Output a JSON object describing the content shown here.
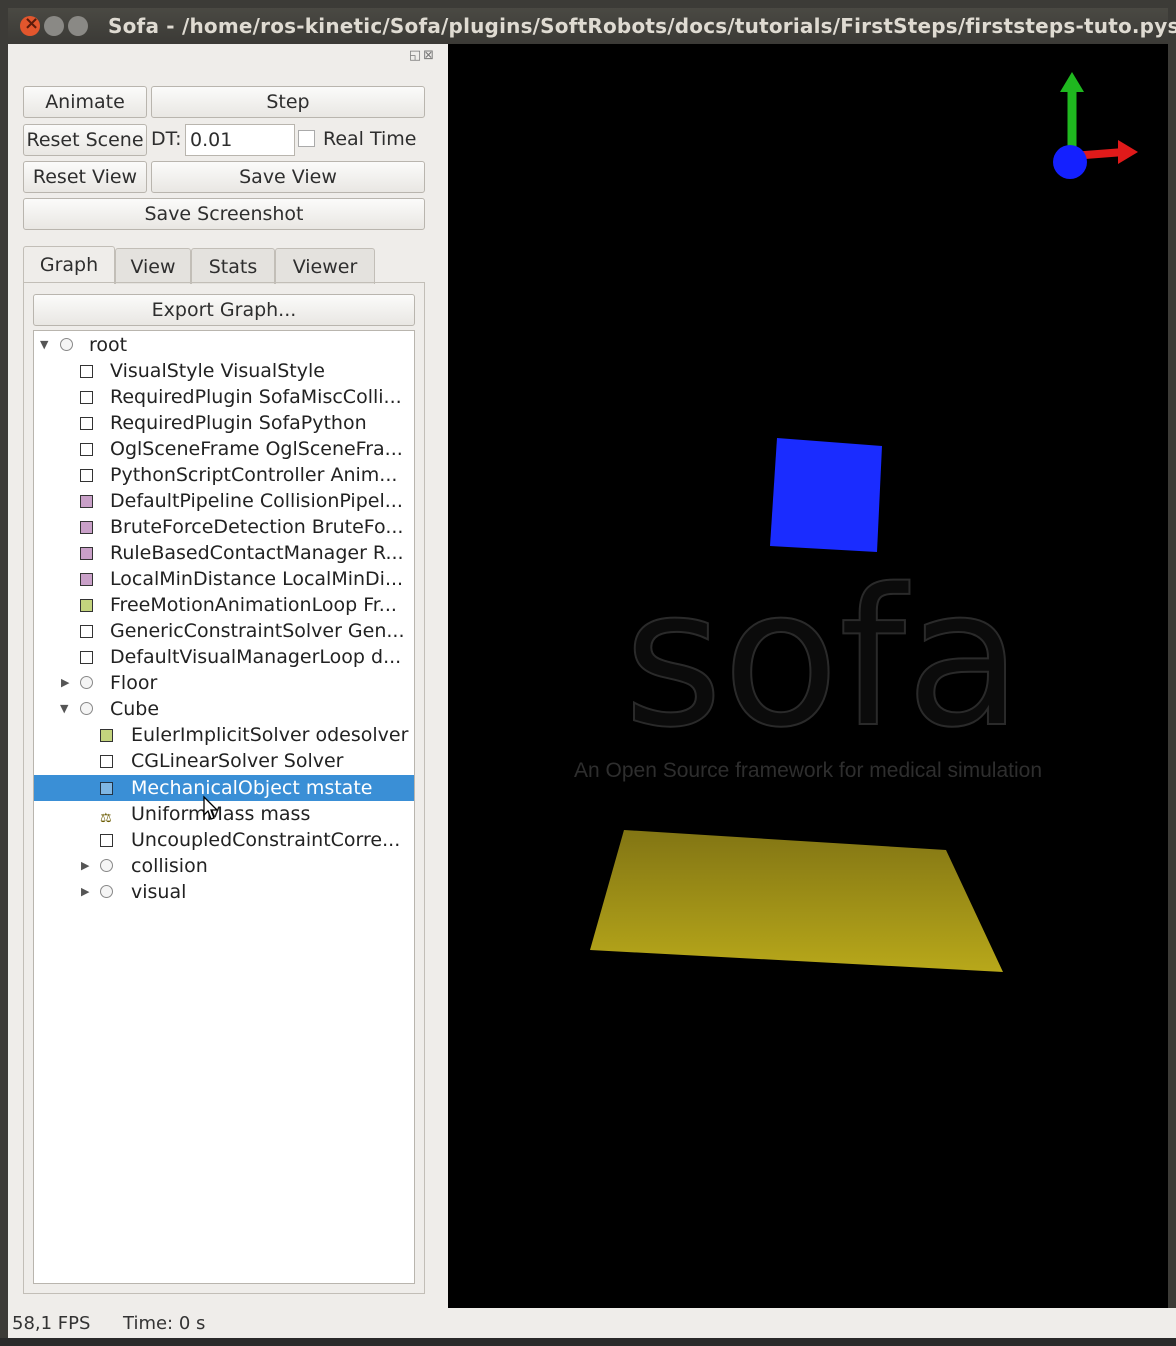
{
  "window": {
    "title": "Sofa - /home/ros-kinetic/Sofa/plugins/SoftRobots/docs/tutorials/FirstSteps/firststeps-tuto.pyscn"
  },
  "controls": {
    "animate": "Animate",
    "step": "Step",
    "reset_scene": "Reset Scene",
    "dt_label": "DT:",
    "dt_value": "0.01",
    "real_time": "Real Time",
    "reset_view": "Reset View",
    "save_view": "Save View",
    "save_screenshot": "Save Screenshot"
  },
  "tabs": [
    {
      "label": "Graph"
    },
    {
      "label": "View"
    },
    {
      "label": "Stats"
    },
    {
      "label": "Viewer"
    }
  ],
  "export_graph": "Export Graph...",
  "tree": [
    {
      "label": "root"
    },
    {
      "label": "VisualStyle VisualStyle"
    },
    {
      "label": "RequiredPlugin SofaMiscColli..."
    },
    {
      "label": "RequiredPlugin SofaPython"
    },
    {
      "label": "OglSceneFrame OglSceneFra..."
    },
    {
      "label": "PythonScriptController Anim..."
    },
    {
      "label": "DefaultPipeline CollisionPipel..."
    },
    {
      "label": "BruteForceDetection BruteFo..."
    },
    {
      "label": "RuleBasedContactManager R..."
    },
    {
      "label": "LocalMinDistance LocalMinDi..."
    },
    {
      "label": "FreeMotionAnimationLoop Fr..."
    },
    {
      "label": "GenericConstraintSolver Gen..."
    },
    {
      "label": "DefaultVisualManagerLoop d..."
    },
    {
      "label": "Floor"
    },
    {
      "label": "Cube"
    },
    {
      "label": "EulerImplicitSolver odesolver"
    },
    {
      "label": "CGLinearSolver Solver"
    },
    {
      "label": "MechanicalObject mstate"
    },
    {
      "label": "UniformMass mass"
    },
    {
      "label": "UncoupledConstraintCorre..."
    },
    {
      "label": "collision"
    },
    {
      "label": "visual"
    }
  ],
  "viewer": {
    "watermark": "sofa",
    "tagline": "An Open Source framework for medical simulation",
    "cube_color": "#1a2cff",
    "floor_color": "#b8a81a"
  },
  "status": {
    "fps": "58,1 FPS",
    "time": "Time: 0 s"
  }
}
